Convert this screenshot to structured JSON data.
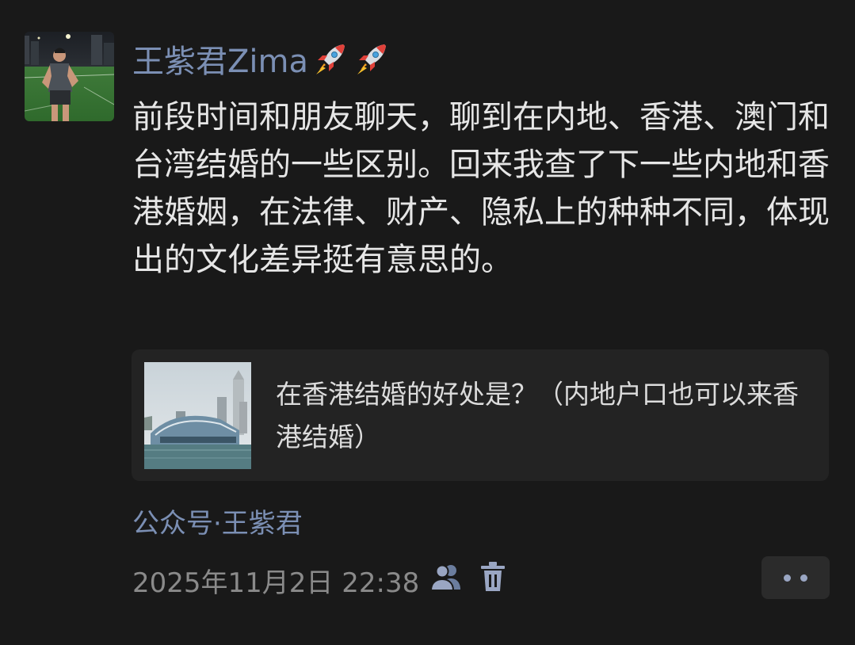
{
  "post": {
    "author": "王紫君Zima",
    "author_emoji": [
      "rocket-icon",
      "rocket-icon"
    ],
    "text": "前段时间和朋友聊天，聊到在内地、香港、澳门和台湾结婚的一些区别。回来我查了下一些内地和香港婚姻，在法律、财产、隐私上的种种不同，体现出的文化差异挺有意思的。",
    "link": {
      "title": "在香港结婚的好处是？（内地户口也可以来香港结婚）"
    },
    "source": "公众号·王紫君",
    "timestamp": "2025年11月2日 22:38"
  },
  "icons": {
    "visibility": "friends-visibility-icon",
    "delete": "trash-icon",
    "more": "more-dots-icon"
  },
  "colors": {
    "background": "#191919",
    "author_name": "#7b8fb4",
    "body_text": "#e6e6e6",
    "card_background": "#232323",
    "meta_text": "#8a8a8a",
    "icon_blue": "#9aa6c3"
  }
}
